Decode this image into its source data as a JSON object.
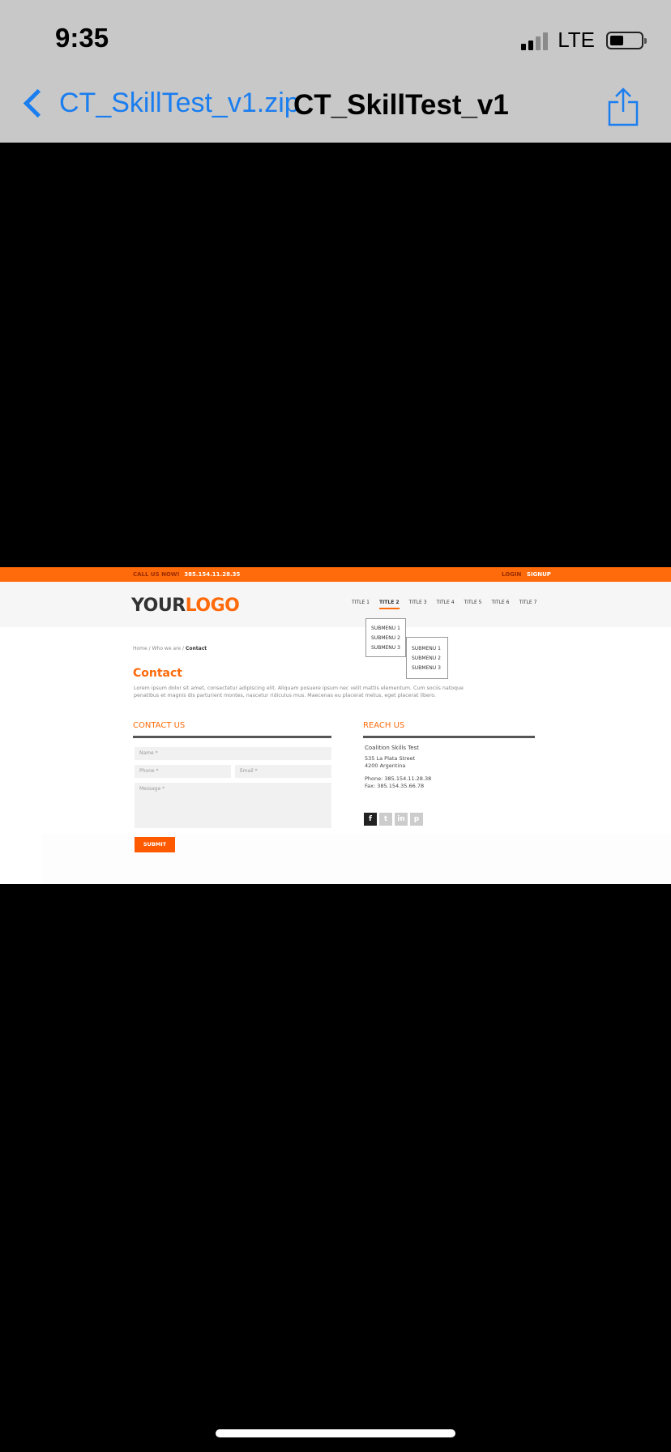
{
  "status_bar": {
    "time": "9:35",
    "network": "LTE",
    "icons": [
      "signal-icon",
      "battery-icon"
    ]
  },
  "nav": {
    "back_label": "CT_SkillTest_v1.zip",
    "title": "CT_SkillTest_v1",
    "back_icon": "chevron-left-icon",
    "share_icon": "share-icon",
    "accent": "#1a7df0"
  },
  "site": {
    "accent": "#ff6a0a",
    "topbar": {
      "call_label": "CALL US NOW!",
      "phone": "385.154.11.28.35",
      "login": "LOGIN",
      "signup": "SIGNUP"
    },
    "logo": {
      "part1": "YOUR",
      "part2": "LOGO"
    },
    "menu": [
      "TITLE 1",
      "TITLE 2",
      "TITLE 3",
      "TITLE 4",
      "TITLE 5",
      "TITLE 6",
      "TITLE 7"
    ],
    "active_menu_index": 1,
    "submenu": [
      "SUBMENU 1",
      "SUBMENU 2",
      "SUBMENU 3"
    ],
    "subsubmenu": [
      "SUBMENU 1",
      "SUBMENU 2",
      "SUBMENU 3"
    ],
    "breadcrumb": {
      "home": "Home",
      "sep": "/",
      "who": "Who we are",
      "current": "Contact"
    },
    "page_title": "Contact",
    "lead": "Lorem ipsum dolor sit amet, consectetur adipiscing elit. Aliquam posuere ipsum nec velit mattis elementum. Cum sociis natoque penatibus et magnis dis parturient montes, nascetur ridiculus mus. Maecenas eu placerat metus, eget placerat libero.",
    "contact": {
      "title": "CONTACT US",
      "name_placeholder": "Name *",
      "phone_placeholder": "Phone *",
      "email_placeholder": "Email *",
      "message_placeholder": "Message *",
      "submit": "SUBMIT"
    },
    "reach": {
      "title": "REACH US",
      "company": "Coalition Skills Test",
      "street": "535 La Plata Street",
      "city": "4200 Argentina",
      "phone": "Phone: 385.154.11.28.38",
      "fax": "Fax: 385.154.35.66.78",
      "social": [
        "facebook-icon",
        "twitter-icon",
        "linkedin-icon",
        "pinterest-icon"
      ]
    }
  }
}
